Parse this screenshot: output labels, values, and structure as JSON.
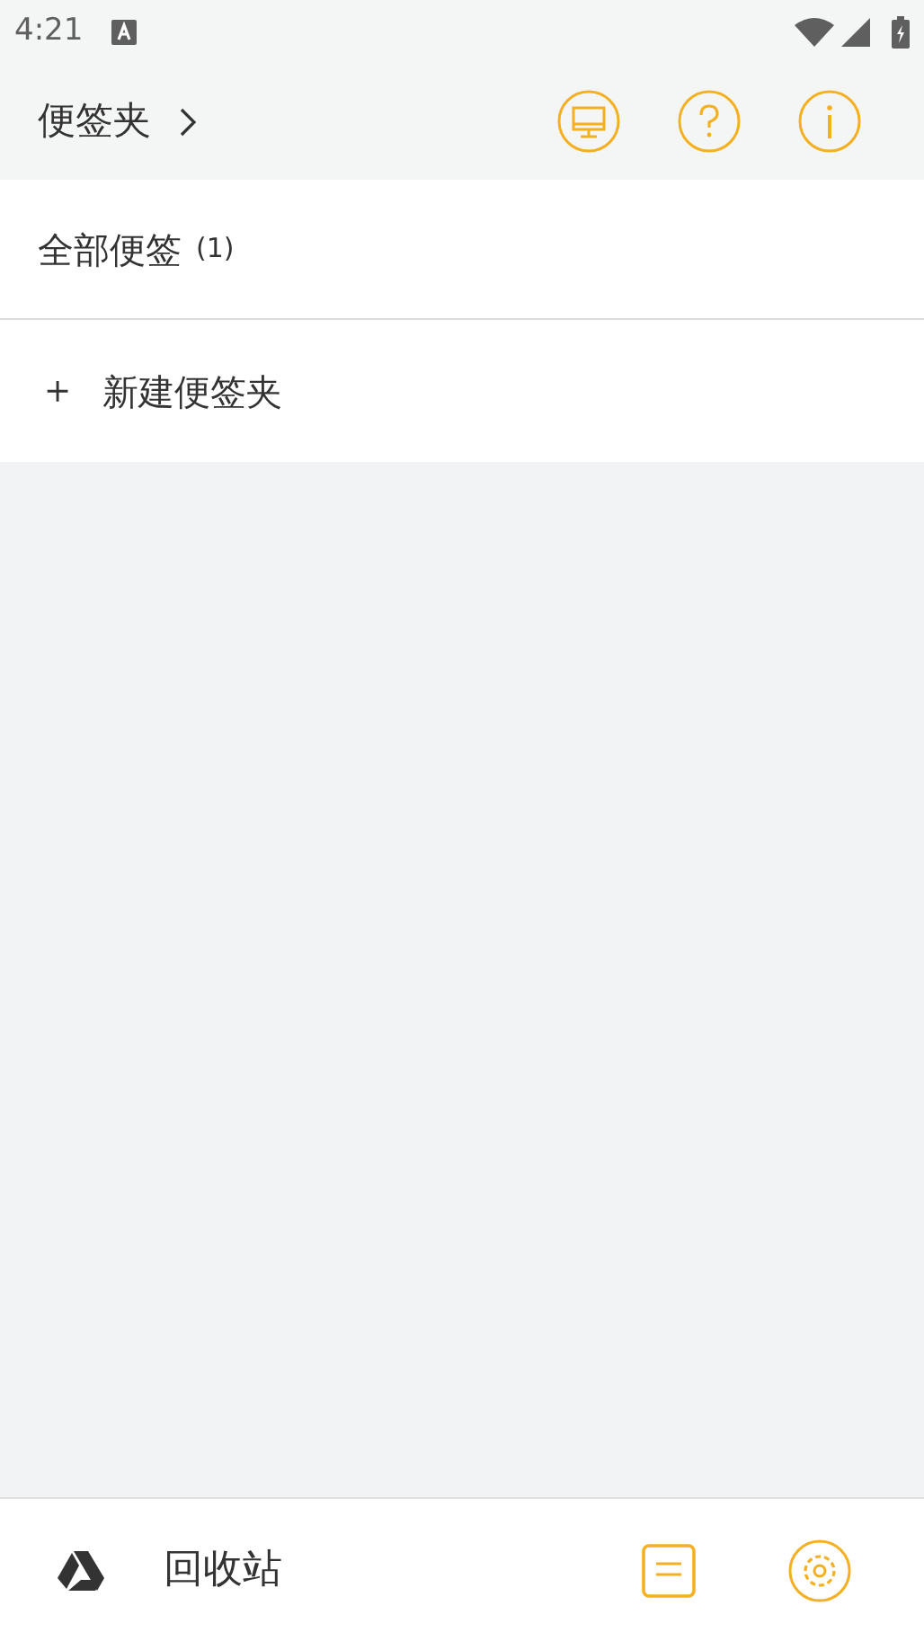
{
  "status_bar": {
    "time": "4:21"
  },
  "header": {
    "title": "便签夹"
  },
  "folders": [
    {
      "name": "全部便签",
      "count": "(1)"
    }
  ],
  "new_folder": {
    "label": "新建便签夹",
    "icon": "＋"
  },
  "bottom_bar": {
    "trash_label": "回收站"
  }
}
